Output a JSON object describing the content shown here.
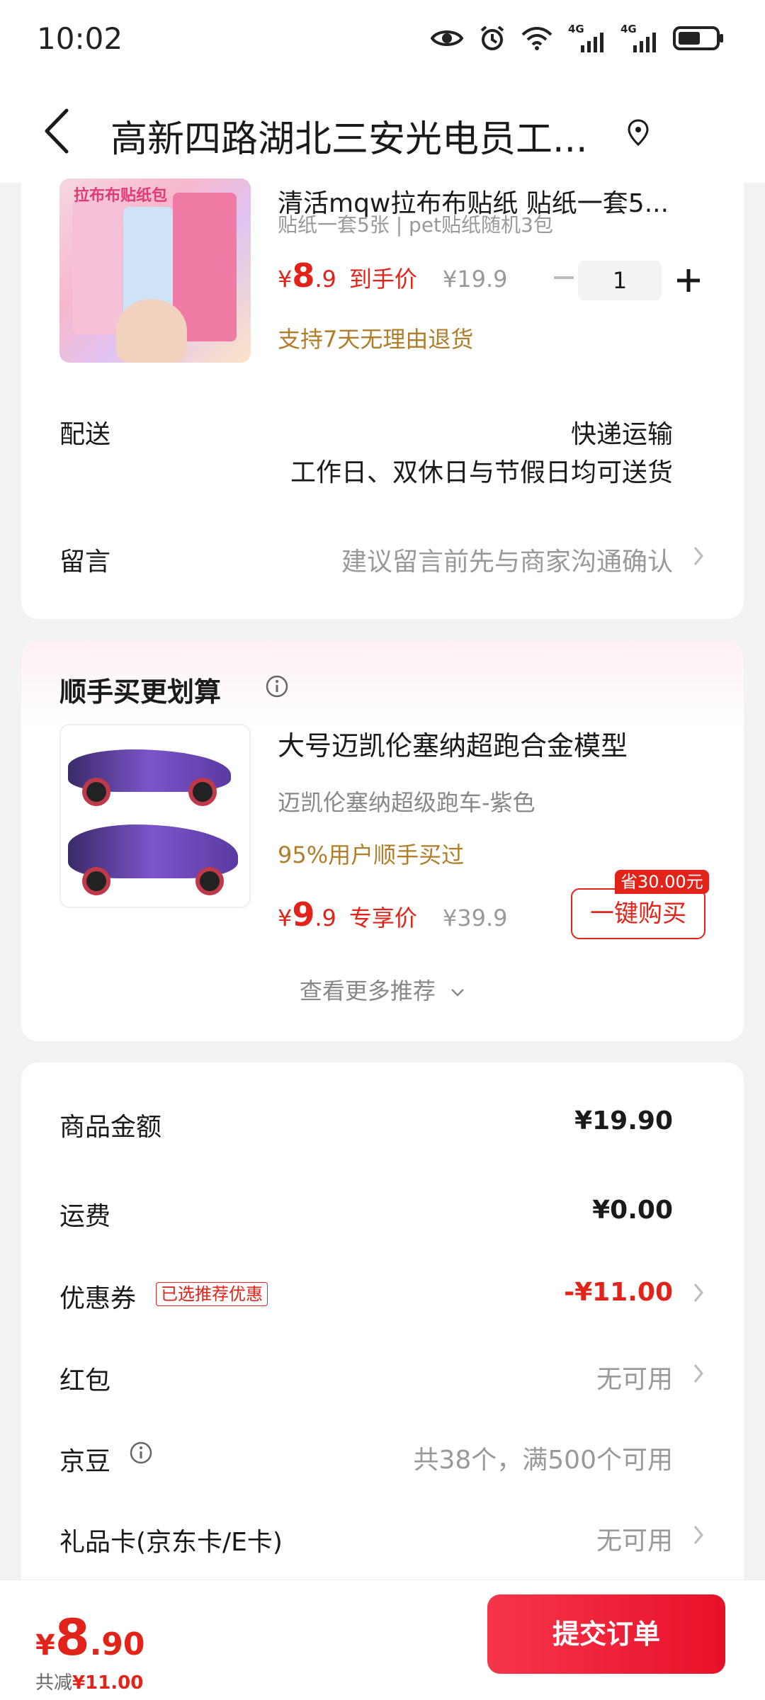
{
  "status_bar": {
    "time": "10:02",
    "network_1": "4G",
    "network_2": "4G"
  },
  "header": {
    "title": "高新四路湖北三安光电员工...",
    "back_icon": "back-arrow-icon",
    "location_icon": "location-pin-icon"
  },
  "product": {
    "image_caption": "拉布布贴纸包",
    "title": "清活mqw拉布布贴纸 贴纸一套5...",
    "spec": "贴纸一套5张 | pet贴纸随机3包",
    "price_symbol": "¥",
    "price_int": "8",
    "price_dec": ".9",
    "price_tag": "到手价",
    "original_price": "¥19.9",
    "quantity": "1",
    "return_note": "支持7天无理由退货"
  },
  "delivery": {
    "label": "配送",
    "method": "快递运输",
    "schedule": "工作日、双休日与节假日均可送货"
  },
  "message": {
    "label": "留言",
    "placeholder": "建议留言前先与商家沟通确认"
  },
  "recommend": {
    "title": "顺手买更划算",
    "product_title": "大号迈凯伦塞纳超跑合金模型",
    "product_spec": "迈凯伦塞纳超级跑车-紫色",
    "buy_rate": "95%用户顺手买过",
    "price_symbol": "¥",
    "price_int": "9",
    "price_dec": ".9",
    "price_tag": "专享价",
    "original_price": "¥39.9",
    "save_badge": "省30.00元",
    "buy_button": "一键购买",
    "more_label": "查看更多推荐"
  },
  "summary": {
    "goods_label": "商品金额",
    "goods_value": "¥19.90",
    "shipping_label": "运费",
    "shipping_value": "¥0.00",
    "coupon_label": "优惠券",
    "coupon_tag": "已选推荐优惠",
    "coupon_value": "-¥11.00",
    "redpacket_label": "红包",
    "redpacket_value": "无可用",
    "jingdou_label": "京豆",
    "jingdou_value": "共38个，满500个可用",
    "giftcard_label": "礼品卡(京东卡/E卡)",
    "giftcard_value": "无可用"
  },
  "bottom": {
    "total_symbol": "¥",
    "total_int": "8",
    "total_dec": ".90",
    "saved_label": "共减",
    "saved_amount": "¥11.00",
    "submit_label": "提交订单"
  },
  "colors": {
    "accent_red": "#e2231a",
    "gold": "#b07d2a",
    "muted_gray": "#999999"
  }
}
